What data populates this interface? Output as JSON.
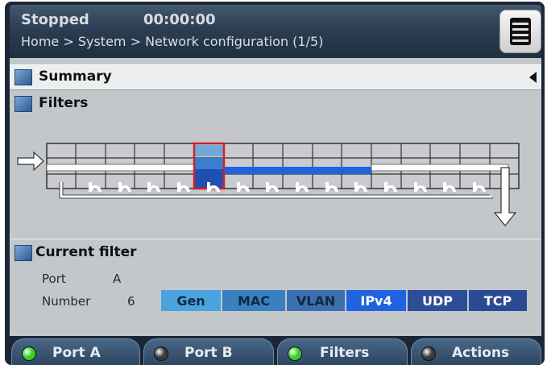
{
  "header": {
    "status": "Stopped",
    "timer": "00:00:00",
    "breadcrumb": "Home > System > Network configuration (1/5)"
  },
  "sections": {
    "summary": "Summary",
    "filters": "Filters",
    "current_filter": "Current filter"
  },
  "current_filter": {
    "port_label": "Port",
    "port_value": "A",
    "number_label": "Number",
    "number_value": "6"
  },
  "filter_tabs": [
    {
      "label": "Gen",
      "bg": "#4aa3df",
      "fg": "#0f2a40"
    },
    {
      "label": "MAC",
      "bg": "#3a7fbf",
      "fg": "#0f2a40"
    },
    {
      "label": "VLAN",
      "bg": "#3b6fb0",
      "fg": "#0f2a40"
    },
    {
      "label": "IPv4",
      "bg": "#1f63e0",
      "fg": "#ffffff"
    },
    {
      "label": "UDP",
      "bg": "#2c4d98",
      "fg": "#ffffff"
    },
    {
      "label": "TCP",
      "bg": "#2b4a93",
      "fg": "#ffffff"
    }
  ],
  "bottom_bar": [
    {
      "label": "Port A",
      "led": "green"
    },
    {
      "label": "Port B",
      "led": "gray"
    },
    {
      "label": "Filters",
      "led": "green"
    },
    {
      "label": "Actions",
      "led": "gray"
    }
  ],
  "colors": {
    "led_green": "#35d12a",
    "led_gray": "#3a3a3a",
    "selected_border": "#d21f2a",
    "active_line": "#1f63e0"
  },
  "icons": [
    "menu-icon",
    "section-icon",
    "collapse-arrow-icon",
    "input-arrow-icon",
    "output-arrow-icon",
    "led-indicator-icon"
  ]
}
